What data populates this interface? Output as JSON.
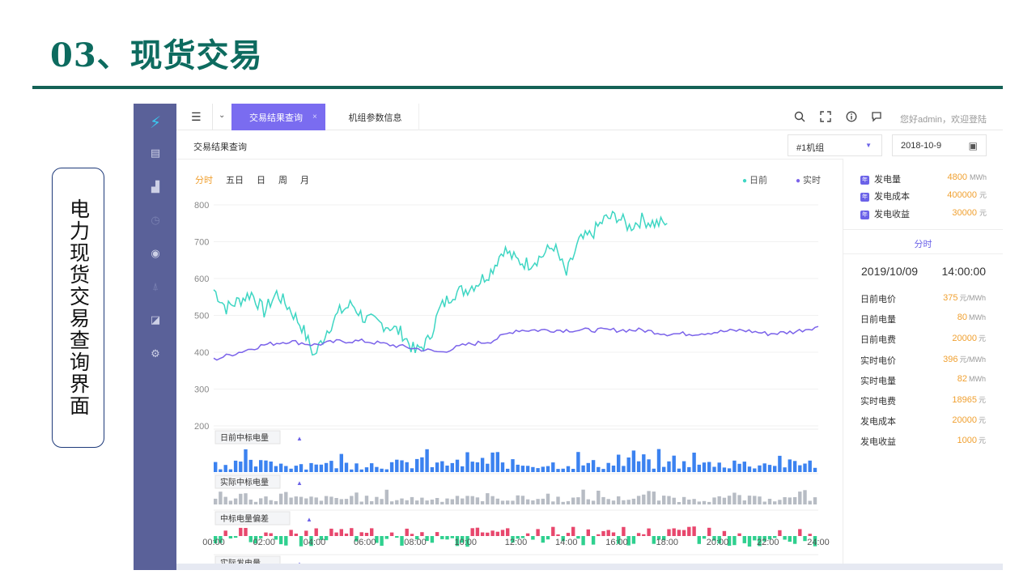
{
  "slide": {
    "title": "03、现货交易",
    "side_label": "电力现货交易查询界面"
  },
  "sidebar": {
    "icons": [
      "logo-icon",
      "document-icon",
      "bar-chart-icon",
      "clock-icon",
      "radar-icon",
      "tower-icon",
      "trend-icon",
      "settings-icon"
    ]
  },
  "topbar": {
    "menu_icon": "☰",
    "chevron": "⌄",
    "tabs": [
      {
        "label": "交易结果查询",
        "close": "×"
      },
      {
        "label": "机组参数信息"
      }
    ],
    "welcome": "您好admin，欢迎登陆",
    "icons": [
      "search-icon",
      "fullscreen-icon",
      "info-icon",
      "message-icon"
    ]
  },
  "subbar": {
    "title": "交易结果查询",
    "unit_select": "#1机组",
    "date": "2018-10-9"
  },
  "periods": [
    "分时",
    "五日",
    "日",
    "周",
    "月"
  ],
  "legend": [
    {
      "label": "日前",
      "color": "#3ed6c3"
    },
    {
      "label": "实时",
      "color": "#7b63ea"
    }
  ],
  "summary": [
    {
      "label": "发电量",
      "value": "4800",
      "unit": "MWh"
    },
    {
      "label": "发电成本",
      "value": "400000",
      "unit": "元"
    },
    {
      "label": "发电收益",
      "value": "30000",
      "unit": "元"
    }
  ],
  "detail": {
    "tab": "分时",
    "date": "2019/10/09",
    "time": "14:00:00",
    "rows": [
      {
        "label": "日前电价",
        "value": "375",
        "unit": "元/MWh"
      },
      {
        "label": "日前电量",
        "value": "80",
        "unit": "MWh"
      },
      {
        "label": "日前电费",
        "value": "20000",
        "unit": "元"
      },
      {
        "label": "实时电价",
        "value": "396",
        "unit": "元/MWh"
      },
      {
        "label": "实时电量",
        "value": "82",
        "unit": "MWh"
      },
      {
        "label": "实时电费",
        "value": "18965",
        "unit": "元"
      },
      {
        "label": "发电成本",
        "value": "20000",
        "unit": "元"
      },
      {
        "label": "发电收益",
        "value": "1000",
        "unit": "元"
      }
    ]
  },
  "chart_data": {
    "type": "line",
    "y_ticks": [
      800,
      700,
      600,
      500,
      400,
      300,
      200
    ],
    "ylim": [
      200,
      800
    ],
    "x_ticks": [
      "00:00",
      "02:00",
      "04:00",
      "06:00",
      "08:00",
      "10:00",
      "12:00",
      "14:00",
      "16:00",
      "18:00",
      "20:00",
      "22:00",
      "24:00"
    ],
    "series": [
      {
        "name": "日前",
        "color": "#3ed6c3",
        "x_hours": [
          0,
          0.5,
          1,
          1.5,
          2,
          2.5,
          3,
          3.5,
          4,
          4.5,
          5,
          5.5,
          6,
          6.5,
          7,
          7.5,
          8,
          8.5,
          9,
          9.5,
          10,
          10.5,
          11,
          11.5,
          12,
          12.5,
          13,
          13.5,
          14,
          14.5,
          15,
          15.5,
          16,
          16.5,
          17,
          17.5,
          18
        ],
        "values": [
          570,
          520,
          540,
          560,
          510,
          560,
          520,
          470,
          390,
          460,
          510,
          530,
          490,
          480,
          470,
          450,
          400,
          430,
          520,
          560,
          570,
          590,
          620,
          680,
          650,
          640,
          660,
          690,
          610,
          700,
          720,
          760,
          770,
          740,
          760,
          750,
          750
        ]
      },
      {
        "name": "实时",
        "color": "#7b63ea",
        "x_hours": [
          0,
          1,
          2,
          3,
          4,
          5,
          6,
          7,
          8,
          9,
          10,
          11,
          12,
          13,
          14,
          15,
          16,
          17,
          18,
          19,
          20,
          21,
          22,
          23,
          24
        ],
        "values": [
          380,
          400,
          420,
          430,
          420,
          430,
          430,
          420,
          410,
          400,
          420,
          430,
          460,
          460,
          460,
          460,
          460,
          460,
          450,
          450,
          455,
          460,
          450,
          455,
          470
        ]
      }
    ],
    "sub_panels": [
      {
        "label": "日前中标电量",
        "toggle": "▲",
        "color": "#3b82f0"
      },
      {
        "label": "实际中标电量",
        "toggle": "▲",
        "color": "#b7bcc4"
      },
      {
        "label": "中标电量偏差",
        "toggle": "▲",
        "pos_color": "#e8476d",
        "neg_color": "#2fd08f"
      },
      {
        "label": "实际发电量",
        "toggle": "▲",
        "color": "#c5c9cf"
      }
    ]
  }
}
